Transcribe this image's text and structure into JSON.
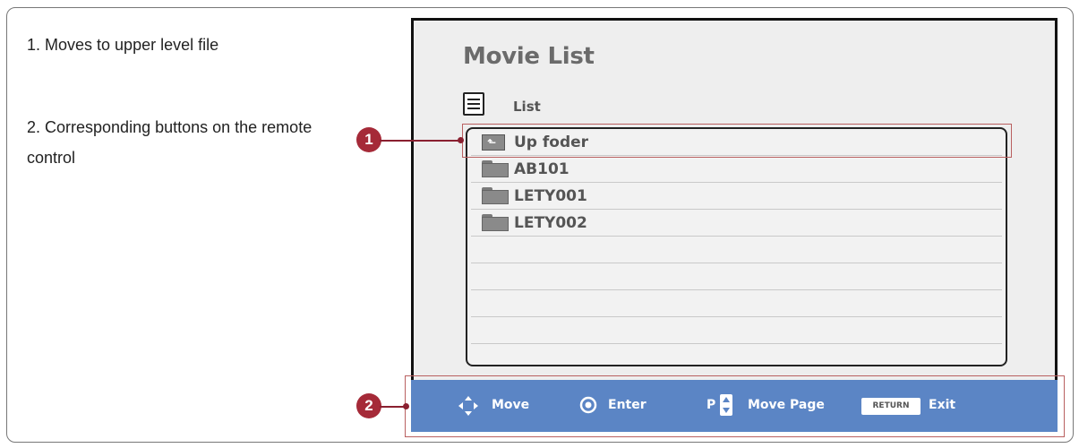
{
  "notes": {
    "note1": "1. Moves to upper level file",
    "note2": "2. Corresponding buttons on the remote control"
  },
  "screen": {
    "title": "Movie List",
    "list_label": "List",
    "items": [
      {
        "label": "Up foder",
        "icon": "up-folder-icon"
      },
      {
        "label": "AB101",
        "icon": "folder-icon"
      },
      {
        "label": "LETY001",
        "icon": "folder-icon"
      },
      {
        "label": "LETY002",
        "icon": "folder-icon"
      }
    ],
    "empty_rows": 5
  },
  "bottom_bar": {
    "move": "Move",
    "enter": "Enter",
    "page_key": "P",
    "move_page": "Move Page",
    "return_key": "RETURN",
    "exit": "Exit"
  },
  "callouts": {
    "c1": "1",
    "c2": "2"
  },
  "colors": {
    "bar_blue": "#5b85c5",
    "callout_red": "#a52a38",
    "highlight_border": "#b96060"
  }
}
